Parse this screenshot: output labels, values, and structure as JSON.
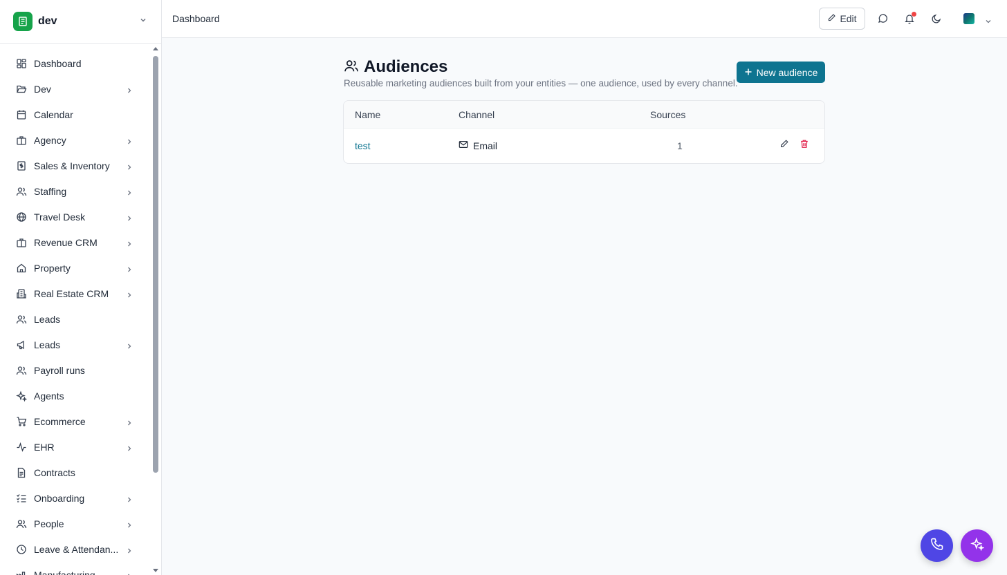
{
  "workspace": {
    "name": "dev",
    "logo_color": "#16a34a"
  },
  "sidebar": {
    "items": [
      {
        "label": "Dashboard",
        "icon": "layout-dashboard-icon",
        "expandable": false
      },
      {
        "label": "Dev",
        "icon": "folder-open-icon",
        "expandable": true
      },
      {
        "label": "Calendar",
        "icon": "calendar-icon",
        "expandable": false
      },
      {
        "label": "Agency",
        "icon": "building-icon",
        "expandable": true
      },
      {
        "label": "Sales & Inventory",
        "icon": "receipt-dollar-icon",
        "expandable": true
      },
      {
        "label": "Staffing",
        "icon": "users-icon",
        "expandable": true
      },
      {
        "label": "Travel Desk",
        "icon": "globe-icon",
        "expandable": true
      },
      {
        "label": "Revenue CRM",
        "icon": "building-icon",
        "expandable": true
      },
      {
        "label": "Property",
        "icon": "home-icon",
        "expandable": true
      },
      {
        "label": "Real Estate CRM",
        "icon": "building-2-icon",
        "expandable": true
      },
      {
        "label": "Leads",
        "icon": "users-icon",
        "expandable": false
      },
      {
        "label": "Leads",
        "icon": "megaphone-icon",
        "expandable": true
      },
      {
        "label": "Payroll runs",
        "icon": "users-icon",
        "expandable": false
      },
      {
        "label": "Agents",
        "icon": "sparkles-icon",
        "expandable": false
      },
      {
        "label": "Ecommerce",
        "icon": "shopping-cart-icon",
        "expandable": true
      },
      {
        "label": "EHR",
        "icon": "activity-icon",
        "expandable": true
      },
      {
        "label": "Contracts",
        "icon": "file-text-icon",
        "expandable": false
      },
      {
        "label": "Onboarding",
        "icon": "list-checks-icon",
        "expandable": true
      },
      {
        "label": "People",
        "icon": "users-icon",
        "expandable": true
      },
      {
        "label": "Leave & Attendan...",
        "icon": "clock-icon",
        "expandable": true
      },
      {
        "label": "Manufacturing",
        "icon": "factory-icon",
        "expandable": true
      }
    ]
  },
  "header": {
    "breadcrumb": "Dashboard",
    "edit_label": "Edit",
    "notification_dot_color": "#ef4444"
  },
  "page": {
    "title": "Audiences",
    "subtitle": "Reusable marketing audiences built from your entities — one audience, used by every channel.",
    "new_button_label": "New audience",
    "accent_color": "#0e7490"
  },
  "table": {
    "columns": [
      "Name",
      "Channel",
      "Sources"
    ],
    "rows": [
      {
        "name": "test",
        "channel": "Email",
        "sources": "1"
      }
    ]
  },
  "fabs": {
    "phone_color": "#4f46e5",
    "ai_color": "#9333ea"
  }
}
